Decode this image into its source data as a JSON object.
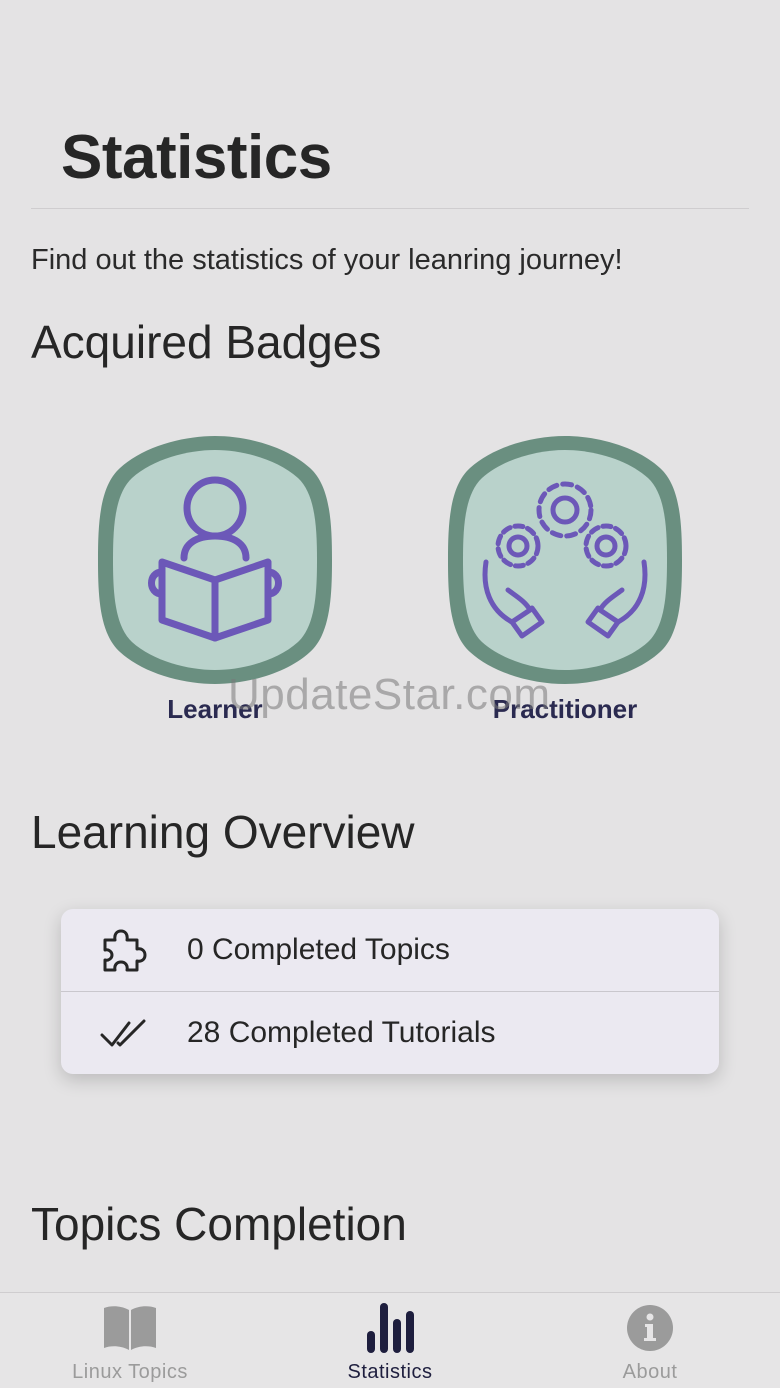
{
  "header": {
    "title": "Statistics"
  },
  "intro_text": "Find out the statistics of your leanring journey!",
  "badges": {
    "heading": "Acquired Badges",
    "items": [
      {
        "label": "Learner",
        "icon": "reader-icon"
      },
      {
        "label": "Practitioner",
        "icon": "gears-hands-icon"
      }
    ]
  },
  "watermark": "UpdateStar.com",
  "overview": {
    "heading": "Learning Overview",
    "rows": [
      {
        "text": "0 Completed Topics",
        "icon": "puzzle-icon"
      },
      {
        "text": "28 Completed Tutorials",
        "icon": "double-check-icon"
      }
    ]
  },
  "topics_completion": {
    "heading": "Topics Completion"
  },
  "tabbar": {
    "tabs": [
      {
        "label": "Linux Topics",
        "icon": "book-icon",
        "active": false
      },
      {
        "label": "Statistics",
        "icon": "bar-chart-icon",
        "active": true
      },
      {
        "label": "About",
        "icon": "info-icon",
        "active": false
      }
    ]
  },
  "colors": {
    "background": "#e4e3e4",
    "badge_ring": "#6a8f80",
    "badge_fill": "#b9d2cb",
    "badge_icon": "#6c58b8",
    "active_tab": "#1e1e3e",
    "inactive_tab": "#9b9b9b"
  }
}
